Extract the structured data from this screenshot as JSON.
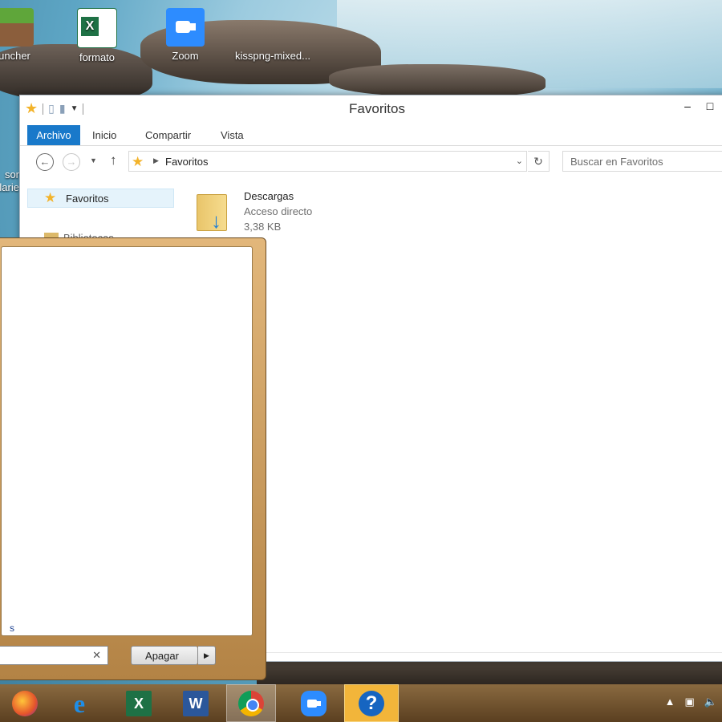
{
  "desktop": {
    "icons": [
      {
        "label": "uncher",
        "icon": "minecraft-launcher-icon"
      },
      {
        "label": "formato",
        "icon": "excel-file-icon"
      },
      {
        "label": "Zoom",
        "icon": "zoom-icon"
      },
      {
        "label": "kisspng-mixed...",
        "icon": "image-file-icon"
      }
    ],
    "side_text": [
      "sor",
      "ilarie"
    ]
  },
  "explorer": {
    "title": "Favoritos",
    "ribbon_tabs": [
      "Archivo",
      "Inicio",
      "Compartir",
      "Vista"
    ],
    "address": "Favoritos",
    "search_placeholder": "Buscar en Favoritos",
    "nav_pane": {
      "favorites": "Favoritos",
      "libraries": "Bibliotecas"
    },
    "items": [
      {
        "name": "Descargas",
        "type": "Acceso directo",
        "size": "3,38 KB"
      }
    ]
  },
  "start_menu": {
    "link_fragment": "s",
    "shutdown_label": "Apagar"
  },
  "taskbar": {
    "apps": [
      "firefox-icon",
      "internet-explorer-icon",
      "excel-icon",
      "word-icon",
      "chrome-icon",
      "zoom-icon",
      "help-icon"
    ],
    "active_app": "chrome-icon"
  },
  "colors": {
    "accent": "#1979ca",
    "selection": "#e5f3fb",
    "taskbar": "#6e5030"
  }
}
